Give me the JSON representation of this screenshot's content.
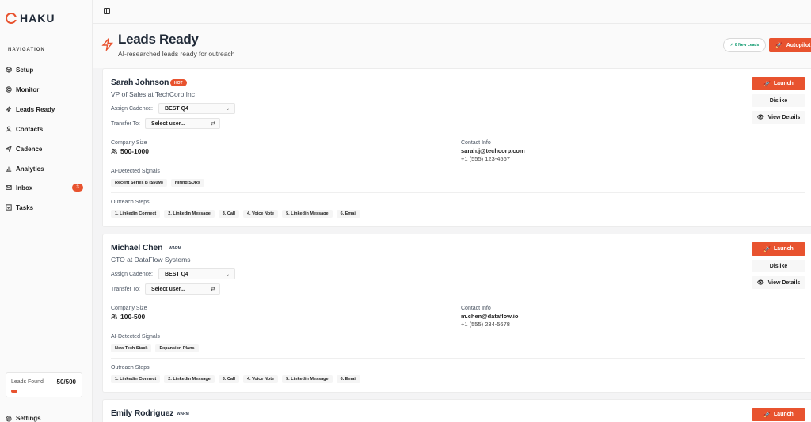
{
  "brand": {
    "name": "HAKU",
    "accent": "#e8532f"
  },
  "sidebar": {
    "heading": "NAVIGATION",
    "items": [
      {
        "label": "Setup",
        "icon": "box-icon"
      },
      {
        "label": "Monitor",
        "icon": "target-icon"
      },
      {
        "label": "Leads Ready",
        "icon": "zap-icon"
      },
      {
        "label": "Contacts",
        "icon": "user-icon"
      },
      {
        "label": "Cadence",
        "icon": "send-icon"
      },
      {
        "label": "Analytics",
        "icon": "bar-chart-icon"
      },
      {
        "label": "Inbox",
        "icon": "mail-icon",
        "badge": "3"
      },
      {
        "label": "Tasks",
        "icon": "checkbox-icon"
      }
    ],
    "leads_found": {
      "label": "Leads Found",
      "count": "50/500",
      "fraction": 0.1
    },
    "settings_label": "Settings"
  },
  "header": {
    "title": "Leads Ready",
    "subtitle": "AI-researched leads ready for outreach",
    "new_leads_label": "8 New Leads",
    "autopilot_label": "Autopilot"
  },
  "labels": {
    "assign_cadence": "Assign Cadence:",
    "transfer_to": "Transfer To:",
    "company_size": "Company Size",
    "contact_info": "Contact Info",
    "signals": "AI-Detected Signals",
    "outreach_steps": "Outreach Steps",
    "launch": "Launch",
    "dislike": "Dislike",
    "view_details": "View Details",
    "transfer_placeholder": "Select user..."
  },
  "leads": [
    {
      "name": "Sarah Johnson",
      "tag": "HOT",
      "role": "VP of Sales at TechCorp Inc",
      "cadence": "BEST Q4",
      "company_size": "500-1000",
      "email": "sarah.j@techcorp.com",
      "phone": "+1 (555) 123-4567",
      "signals": [
        "Recent Series B ($50M)",
        "Hiring SDRs"
      ],
      "steps": [
        "1. Linkedin Connect",
        "2. Linkedin Message",
        "3. Call",
        "4. Voice Note",
        "5. Linkedin Message",
        "6. Email"
      ]
    },
    {
      "name": "Michael Chen",
      "tag": "WARM",
      "role": "CTO at DataFlow Systems",
      "cadence": "BEST Q4",
      "company_size": "100-500",
      "email": "m.chen@dataflow.io",
      "phone": "+1 (555) 234-5678",
      "signals": [
        "New Tech Stack",
        "Expansion Plans"
      ],
      "steps": [
        "1. Linkedin Connect",
        "2. Linkedin Message",
        "3. Call",
        "4. Voice Note",
        "5. Linkedin Message",
        "6. Email"
      ]
    },
    {
      "name": "Emily Rodriguez",
      "tag": "WARM"
    }
  ]
}
